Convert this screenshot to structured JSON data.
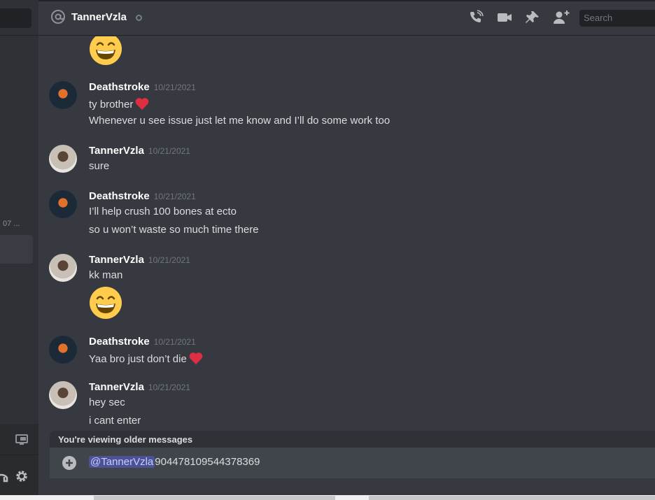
{
  "header": {
    "title": "TannerVzla",
    "search_placeholder": "Search",
    "icons": [
      "at-icon",
      "status-offline-icon",
      "voice-call-icon",
      "video-call-icon",
      "pin-icon",
      "add-friend-icon"
    ]
  },
  "sidebar": {
    "truncated_text": "07 ..."
  },
  "messages": [
    {
      "author": "Deathstroke",
      "timestamp": "10/21/2021",
      "lines": [
        "ty brother",
        "Whenever u see issue just let me know and I’ll do some work too"
      ]
    },
    {
      "author": "TannerVzla",
      "timestamp": "10/21/2021",
      "lines": [
        "sure"
      ]
    },
    {
      "author": "Deathstroke",
      "timestamp": "10/21/2021",
      "lines": [
        "I’ll help crush 100 bones at ecto",
        "so u won’t waste so much time there"
      ]
    },
    {
      "author": "TannerVzla",
      "timestamp": "10/21/2021",
      "lines": [
        "kk man"
      ]
    },
    {
      "author": "Deathstroke",
      "timestamp": "10/21/2021",
      "lines": [
        "Yaa bro just don’t die"
      ]
    },
    {
      "author": "TannerVzla",
      "timestamp": "10/21/2021",
      "lines": [
        "hey sec",
        "i cant enter"
      ]
    }
  ],
  "older_banner": "You're viewing older messages",
  "composer": {
    "mention": "@TannerVzla",
    "text": "904478109544378369"
  },
  "colors": {
    "background": "#36393f",
    "sidebar": "#2f3136",
    "composer": "#40444b",
    "heart": "#dd2e44",
    "emoji": "#ffcc4d"
  }
}
